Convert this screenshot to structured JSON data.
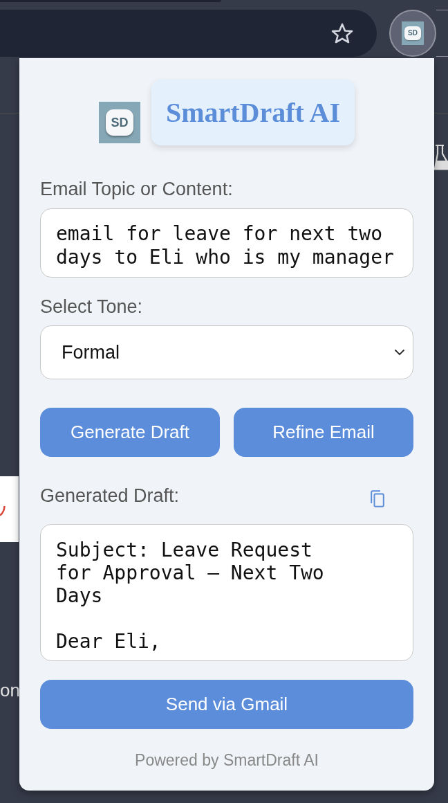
{
  "browser": {
    "extension_logo_text": "SD"
  },
  "background_page": {
    "text_fragment": "on"
  },
  "popup": {
    "logo_text": "SD",
    "title": "SmartDraft AI",
    "topic": {
      "label": "Email Topic or Content:",
      "value": "email for leave for next two days to Eli who is my manager"
    },
    "tone": {
      "label": "Select Tone:",
      "value": "Formal"
    },
    "actions": [
      "Generate Draft",
      "Refine Email"
    ],
    "draft": {
      "label": "Generated Draft:",
      "value": "Subject: Leave Request\nfor Approval – Next Two\nDays\n\nDear Eli,"
    },
    "send_button": "Send via Gmail",
    "footer": "Powered by SmartDraft AI"
  }
}
